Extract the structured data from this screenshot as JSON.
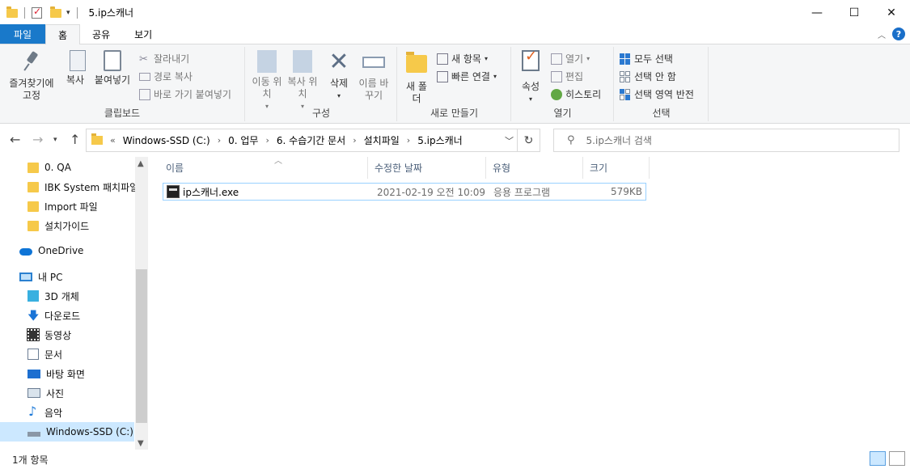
{
  "window": {
    "title": "5.ip스캐너",
    "controls": [
      "—",
      "☐",
      "✕"
    ]
  },
  "tabs": [
    "파일",
    "홈",
    "공유",
    "보기"
  ],
  "ribbon": {
    "clipboard": {
      "label": "클립보드",
      "pin": "즐겨찾기에 고정",
      "copy": "복사",
      "paste": "붙여넣기",
      "cut": "잘라내기",
      "copy_path": "경로 복사",
      "paste_shortcut": "바로 가기 붙여넣기"
    },
    "organize": {
      "label": "구성",
      "move_to": "이동 위치",
      "copy_to": "복사 위치",
      "delete": "삭제",
      "rename": "이름 바꾸기"
    },
    "new": {
      "label": "새로 만들기",
      "new_folder": "새 폴더",
      "new_item": "새 항목",
      "easy_access": "빠른 연결"
    },
    "open": {
      "label": "열기",
      "properties": "속성",
      "open": "열기",
      "edit": "편집",
      "history": "히스토리"
    },
    "select": {
      "label": "선택",
      "select_all": "모두 선택",
      "select_none": "선택 안 함",
      "invert": "선택 영역 반전"
    }
  },
  "address": {
    "crumbs": [
      "Windows-SSD (C:)",
      "0. 업무",
      "6. 수습기간 문서",
      "설치파일",
      "5.ip스캐너"
    ],
    "search_placeholder": "5.ip스캐너 검색"
  },
  "nav": {
    "items": [
      {
        "label": "0. QA",
        "icon": "folder-icon"
      },
      {
        "label": "IBK System 패치파일",
        "icon": "folder-icon"
      },
      {
        "label": "Import 파일",
        "icon": "folder-icon"
      },
      {
        "label": "설치가이드",
        "icon": "folder-icon"
      },
      {
        "label": "OneDrive",
        "icon": "cloud-icon"
      },
      {
        "label": "내 PC",
        "icon": "pc-icon"
      },
      {
        "label": "3D 개체",
        "icon": "cube-icon"
      },
      {
        "label": "다운로드",
        "icon": "download-icon"
      },
      {
        "label": "동영상",
        "icon": "video-icon"
      },
      {
        "label": "문서",
        "icon": "document-icon"
      },
      {
        "label": "바탕 화면",
        "icon": "desktop-icon"
      },
      {
        "label": "사진",
        "icon": "picture-icon"
      },
      {
        "label": "음악",
        "icon": "music-icon"
      },
      {
        "label": "Windows-SSD (C:)",
        "icon": "drive-icon"
      }
    ]
  },
  "columns": {
    "name": "이름",
    "modified": "수정한 날짜",
    "type": "유형",
    "size": "크기"
  },
  "files": [
    {
      "name": "ip스캐너.exe",
      "modified": "2021-02-19 오전 10:09",
      "type": "응용 프로그램",
      "size": "579KB"
    }
  ],
  "status": {
    "count": "1개 항목"
  }
}
